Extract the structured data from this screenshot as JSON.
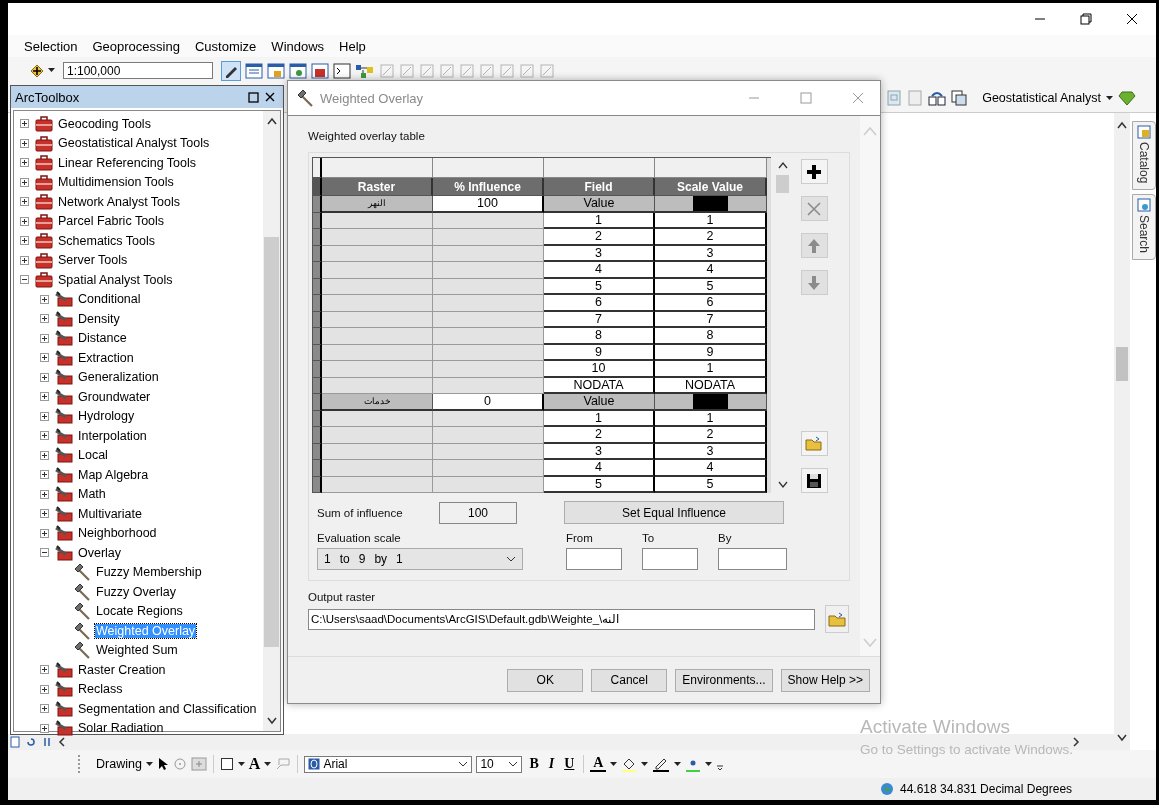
{
  "menu": [
    {
      "label": "Selection"
    },
    {
      "label": "Geoprocessing"
    },
    {
      "label": "Customize"
    },
    {
      "label": "Windows"
    },
    {
      "label": "Help"
    }
  ],
  "toolbar": {
    "scale": "1:100,000",
    "geostatistical_menu": "Geostatistical Analyst"
  },
  "side_tabs": [
    {
      "label": "Catalog"
    },
    {
      "label": "Search"
    }
  ],
  "toolbox": {
    "title": "ArcToolbox",
    "items": [
      {
        "label": "Geocoding Tools",
        "kind": "toolbox",
        "expanded": false
      },
      {
        "label": "Geostatistical Analyst Tools",
        "kind": "toolbox",
        "expanded": false
      },
      {
        "label": "Linear Referencing Tools",
        "kind": "toolbox",
        "expanded": false
      },
      {
        "label": "Multidimension Tools",
        "kind": "toolbox",
        "expanded": false
      },
      {
        "label": "Network Analyst Tools",
        "kind": "toolbox",
        "expanded": false
      },
      {
        "label": "Parcel Fabric Tools",
        "kind": "toolbox",
        "expanded": false
      },
      {
        "label": "Schematics Tools",
        "kind": "toolbox",
        "expanded": false
      },
      {
        "label": "Server Tools",
        "kind": "toolbox",
        "expanded": false
      },
      {
        "label": "Spatial Analyst Tools",
        "kind": "toolbox",
        "expanded": true,
        "children": [
          {
            "label": "Conditional",
            "kind": "toolset",
            "expanded": false
          },
          {
            "label": "Density",
            "kind": "toolset",
            "expanded": false
          },
          {
            "label": "Distance",
            "kind": "toolset",
            "expanded": false
          },
          {
            "label": "Extraction",
            "kind": "toolset",
            "expanded": false
          },
          {
            "label": "Generalization",
            "kind": "toolset",
            "expanded": false
          },
          {
            "label": "Groundwater",
            "kind": "toolset",
            "expanded": false
          },
          {
            "label": "Hydrology",
            "kind": "toolset",
            "expanded": false
          },
          {
            "label": "Interpolation",
            "kind": "toolset",
            "expanded": false
          },
          {
            "label": "Local",
            "kind": "toolset",
            "expanded": false
          },
          {
            "label": "Map Algebra",
            "kind": "toolset",
            "expanded": false
          },
          {
            "label": "Math",
            "kind": "toolset",
            "expanded": false
          },
          {
            "label": "Multivariate",
            "kind": "toolset",
            "expanded": false
          },
          {
            "label": "Neighborhood",
            "kind": "toolset",
            "expanded": false
          },
          {
            "label": "Overlay",
            "kind": "toolset",
            "expanded": true,
            "children": [
              {
                "label": "Fuzzy Membership",
                "kind": "tool",
                "selected": false
              },
              {
                "label": "Fuzzy Overlay",
                "kind": "tool",
                "selected": false
              },
              {
                "label": "Locate Regions",
                "kind": "tool",
                "selected": false
              },
              {
                "label": "Weighted Overlay",
                "kind": "tool",
                "selected": true
              },
              {
                "label": "Weighted Sum",
                "kind": "tool",
                "selected": false
              }
            ]
          },
          {
            "label": "Raster Creation",
            "kind": "toolset",
            "expanded": false
          },
          {
            "label": "Reclass",
            "kind": "toolset",
            "expanded": false
          },
          {
            "label": "Segmentation and Classification",
            "kind": "toolset",
            "expanded": false
          },
          {
            "label": "Solar Radiation",
            "kind": "toolset",
            "expanded": false
          }
        ]
      }
    ]
  },
  "dialog": {
    "title": "Weighted Overlay",
    "table_label": "Weighted overlay table",
    "columns": [
      "Raster",
      "% Influence",
      "Field",
      "Scale Value"
    ],
    "rasters": [
      {
        "name": "النهر",
        "influence": "100",
        "field": "Value",
        "remap": [
          {
            "value": "1",
            "scale": "1"
          },
          {
            "value": "2",
            "scale": "2"
          },
          {
            "value": "3",
            "scale": "3"
          },
          {
            "value": "4",
            "scale": "4"
          },
          {
            "value": "5",
            "scale": "5"
          },
          {
            "value": "6",
            "scale": "6"
          },
          {
            "value": "7",
            "scale": "7"
          },
          {
            "value": "8",
            "scale": "8"
          },
          {
            "value": "9",
            "scale": "9"
          },
          {
            "value": "10",
            "scale": "1"
          },
          {
            "value": "NODATA",
            "scale": "NODATA"
          }
        ]
      },
      {
        "name": "خدمات",
        "influence": "0",
        "field": "Value",
        "remap": [
          {
            "value": "1",
            "scale": "1"
          },
          {
            "value": "2",
            "scale": "2"
          },
          {
            "value": "3",
            "scale": "3"
          },
          {
            "value": "4",
            "scale": "4"
          },
          {
            "value": "5",
            "scale": "5"
          }
        ]
      }
    ],
    "table_buttons": [
      {
        "kind": "add",
        "disabled": false
      },
      {
        "kind": "delete",
        "disabled": true
      },
      {
        "kind": "up",
        "disabled": true
      },
      {
        "kind": "down",
        "disabled": true
      },
      {
        "kind": "open",
        "disabled": false
      },
      {
        "kind": "save",
        "disabled": false
      }
    ],
    "sum_label": "Sum of influence",
    "sum_value": "100",
    "equal_button": "Set Equal Influence",
    "scale_label": "Evaluation scale",
    "scale_parts": [
      "1",
      "to",
      "9",
      "by",
      "1"
    ],
    "from_label": "From",
    "to_label": "To",
    "by_label": "By",
    "output_label": "Output raster",
    "output_value": "C:\\Users\\saad\\Documents\\ArcGIS\\Default.gdb\\Weighte_\\النه",
    "buttons": [
      "OK",
      "Cancel",
      "Environments...",
      "Show Help >>"
    ]
  },
  "drawing_toolbar": {
    "menu": "Drawing",
    "text_tool": "A",
    "font": "Arial",
    "size": "10",
    "bold": "B",
    "italic": "I",
    "underline": "U",
    "font_color": "A"
  },
  "status": {
    "coordinates": "44.618  34.831 Decimal Degrees"
  },
  "activation": {
    "title": "Activate Windows",
    "text": "Go to Settings to activate Windows."
  }
}
